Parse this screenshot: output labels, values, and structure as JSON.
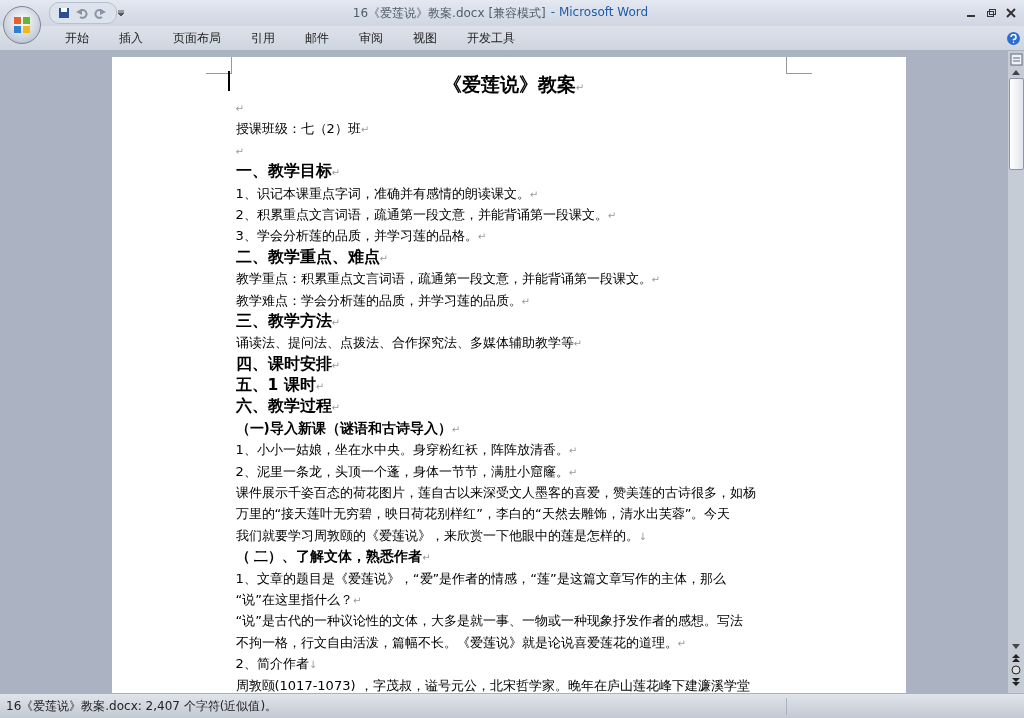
{
  "window": {
    "title": "16《爱莲说》教案.docx [兼容模式]",
    "app_name": "- Microsoft Word"
  },
  "tabs": [
    "开始",
    "插入",
    "页面布局",
    "引用",
    "邮件",
    "审阅",
    "视图",
    "开发工具"
  ],
  "document": [
    {
      "kind": "title",
      "lines": [
        "《爱莲说》教案"
      ],
      "mark": "↵"
    },
    {
      "kind": "blank",
      "mark": "↵"
    },
    {
      "kind": "body",
      "lines": [
        "授课班级：七（2）班"
      ],
      "mark": "↵"
    },
    {
      "kind": "blank",
      "mark": "↵"
    },
    {
      "kind": "heading",
      "lines": [
        "一、教学目标"
      ],
      "mark": "↵"
    },
    {
      "kind": "body",
      "lines": [
        "1、识记本课重点字词，准确并有感情的朗读课文。"
      ],
      "mark": "↵"
    },
    {
      "kind": "body",
      "lines": [
        "2、积累重点文言词语，疏通第一段文意，并能背诵第一段课文。"
      ],
      "mark": "↵"
    },
    {
      "kind": "body",
      "lines": [
        "3、学会分析莲的品质，并学习莲的品格。"
      ],
      "mark": "↵"
    },
    {
      "kind": "heading",
      "lines": [
        "二、教学重点、难点"
      ],
      "mark": "↵"
    },
    {
      "kind": "body",
      "lines": [
        "教学重点：积累重点文言词语，疏通第一段文意，并能背诵第一段课文。"
      ],
      "mark": "↵"
    },
    {
      "kind": "body",
      "lines": [
        "教学难点：学会分析莲的品质，并学习莲的品质。"
      ],
      "mark": "↵"
    },
    {
      "kind": "heading",
      "lines": [
        "三、教学方法"
      ],
      "mark": "↵"
    },
    {
      "kind": "body",
      "lines": [
        "诵读法、提问法、点拨法、合作探究法、多媒体辅助教学等"
      ],
      "mark": "↵"
    },
    {
      "kind": "heading",
      "lines": [
        "四、课时安排"
      ],
      "mark": "↵"
    },
    {
      "kind": "heading",
      "lines": [
        "五、1 课时"
      ],
      "mark": "↵"
    },
    {
      "kind": "heading",
      "lines": [
        "六、教学过程"
      ],
      "mark": "↵"
    },
    {
      "kind": "subheading",
      "lines": [
        "（一)导入新课（谜语和古诗导入）"
      ],
      "mark": "↵"
    },
    {
      "kind": "body",
      "lines": [
        "1、小小一姑娘，坐在水中央。身穿粉红袄，阵阵放清香。"
      ],
      "mark": "↵"
    },
    {
      "kind": "body",
      "lines": [
        "2、泥里一条龙，头顶一个蓬，身体一节节，满肚小窟窿。"
      ],
      "mark": "↵"
    },
    {
      "kind": "body",
      "lines": [
        "课件展示千姿百态的荷花图片，莲自古以来深受文人墨客的喜爱，赞美莲的古诗很多，如杨",
        "万里的“接天莲叶无穷碧，映日荷花别样红”，李白的“天然去雕饰，清水出芙蓉”。今天",
        "我们就要学习周敦颐的《爱莲说》，来欣赏一下他眼中的莲是怎样的。"
      ],
      "mark": "↓"
    },
    {
      "kind": "subheading",
      "lines": [
        "（ 二）、了解文体，熟悉作者"
      ],
      "mark": "↵"
    },
    {
      "kind": "body",
      "lines": [
        "1、文章的题目是《爱莲说》，“爱”是作者的情感，“莲”是这篇文章写作的主体，那么",
        "“说”在这里指什么？"
      ],
      "mark": "↵"
    },
    {
      "kind": "body",
      "lines": [
        "“说”是古代的一种议论性的文体，大多是就一事、一物或一种现象抒发作者的感想。写法",
        "不拘一格，行文自由活泼，篇幅不长。《爱莲说》就是论说喜爱莲花的道理。"
      ],
      "mark": "↵"
    },
    {
      "kind": "body",
      "lines": [
        "2、简介作者"
      ],
      "mark": "↓"
    },
    {
      "kind": "body",
      "lines": [
        " 周敦颐(1017-1073) ，字茂叔，谥号元公，北宋哲学家。晚年在庐山莲花峰下建濂溪学堂"
      ]
    }
  ],
  "status_bar": "16《爱莲说》教案.docx: 2,407 个字符(近似值)。"
}
